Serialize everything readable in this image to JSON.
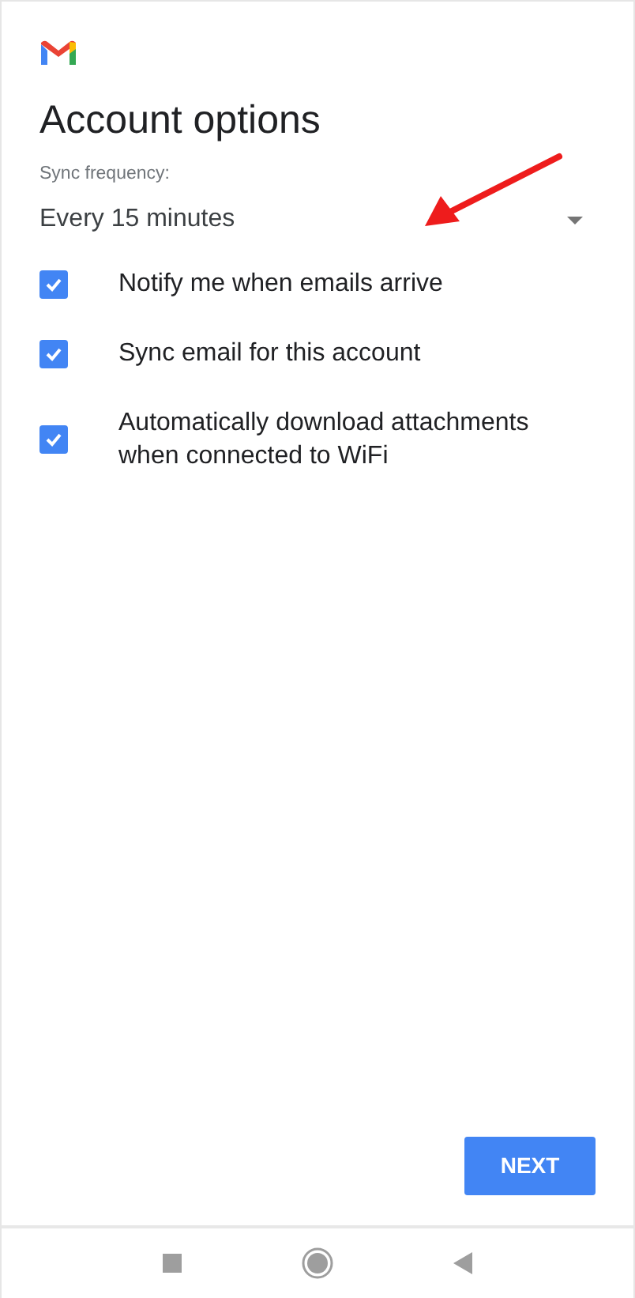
{
  "title": "Account options",
  "sync_frequency": {
    "label": "Sync frequency:",
    "value": "Every 15 minutes"
  },
  "options": [
    {
      "label": "Notify me when emails arrive",
      "checked": true
    },
    {
      "label": "Sync email for this account",
      "checked": true
    },
    {
      "label": "Automatically download attachments when connected to WiFi",
      "checked": true
    }
  ],
  "next_button": "NEXT"
}
